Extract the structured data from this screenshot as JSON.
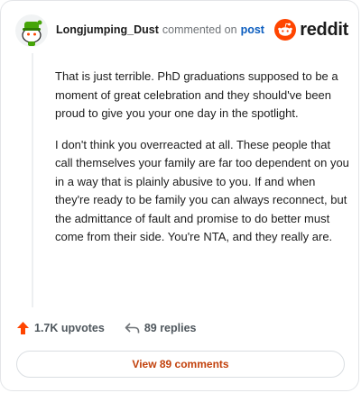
{
  "comment": {
    "author": "Longjumping_Dust",
    "action": "commented on",
    "target": "post",
    "brand": "reddit",
    "paragraphs": [
      "That is just terrible. PhD graduations supposed to be a moment of great celebration and they should've been proud to give you your one day in the spotlight.",
      "I don't think you overreacted at all. These people that call themselves your family are far too dependent on you in a way that is plainly abusive to you. If and when they're ready to be family you can always reconnect, but the admittance of fault and promise to do better must come from their side. You're NTA, and they really are."
    ],
    "upvotes": "1.7K upvotes",
    "replies": "89 replies",
    "view_label": "View 89 comments"
  },
  "colors": {
    "brand_orange": "#ff4500",
    "link_blue": "#0b5dbf",
    "view_text": "#c2410c"
  },
  "icons": {
    "avatar": "snoo-avatar-icon",
    "brand": "reddit-logo-icon",
    "upvote": "upvote-arrow-icon",
    "reply": "reply-arrow-icon"
  }
}
